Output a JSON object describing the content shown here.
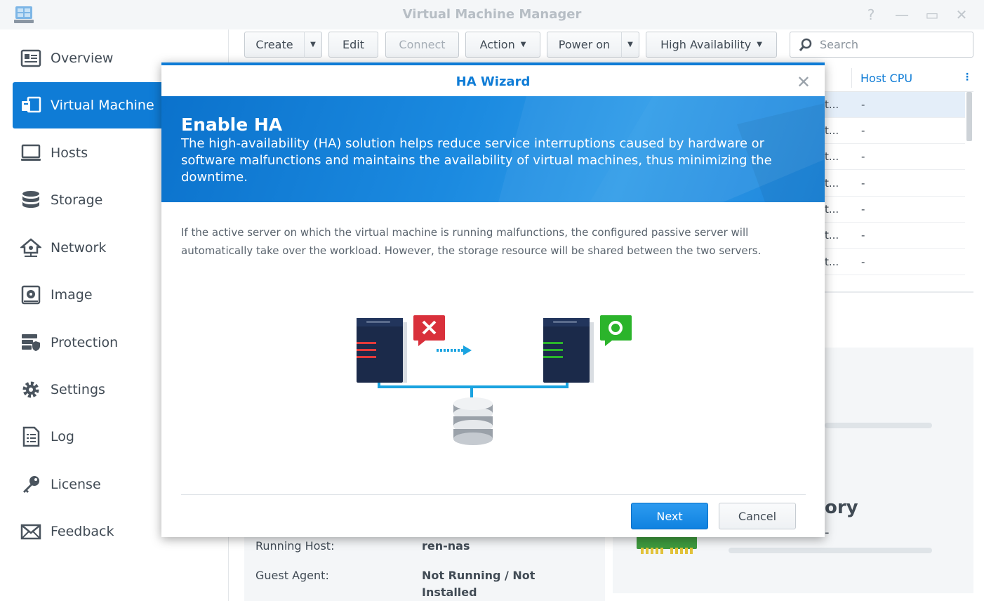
{
  "window": {
    "title": "Virtual Machine Manager",
    "help_icon": "?",
    "minimize_icon": "—",
    "maximize_icon": "▭",
    "close_icon": "✕"
  },
  "sidebar": {
    "items": [
      {
        "label": "Overview",
        "icon": "overview-icon",
        "active": false
      },
      {
        "label": "Virtual Machine",
        "icon": "virtual-machine-icon",
        "active": true
      },
      {
        "label": "Hosts",
        "icon": "hosts-icon",
        "active": false
      },
      {
        "label": "Storage",
        "icon": "storage-icon",
        "active": false
      },
      {
        "label": "Network",
        "icon": "network-icon",
        "active": false
      },
      {
        "label": "Image",
        "icon": "image-icon",
        "active": false
      },
      {
        "label": "Protection",
        "icon": "protection-icon",
        "active": false
      },
      {
        "label": "Settings",
        "icon": "settings-icon",
        "active": false
      },
      {
        "label": "Log",
        "icon": "log-icon",
        "active": false
      },
      {
        "label": "License",
        "icon": "license-icon",
        "active": false
      },
      {
        "label": "Feedback",
        "icon": "feedback-icon",
        "active": false
      }
    ]
  },
  "toolbar": {
    "create": "Create",
    "edit": "Edit",
    "connect": "Connect",
    "action": "Action",
    "power_on": "Power on",
    "high_availability": "High Availability",
    "search_placeholder": "Search"
  },
  "grid": {
    "columns": [
      "Host CPU"
    ],
    "rows": [
      {
        "c1": "t...",
        "c2": "-",
        "selected": true
      },
      {
        "c1": "t...",
        "c2": "-",
        "selected": false
      },
      {
        "c1": "t...",
        "c2": "-",
        "selected": false
      },
      {
        "c1": "t...",
        "c2": "-",
        "selected": false
      },
      {
        "c1": "t...",
        "c2": "-",
        "selected": false
      },
      {
        "c1": "t...",
        "c2": "-",
        "selected": false
      },
      {
        "c1": "t...",
        "c2": "-",
        "selected": false
      }
    ]
  },
  "summary": {
    "memory_title_fragment": "ory",
    "dash": "-",
    "running_host_label": "Running Host:",
    "running_host_value": "ren-nas",
    "guest_agent_label": "Guest Agent:",
    "guest_agent_value": "Not Running / Not Installed"
  },
  "dialog": {
    "title": "HA Wizard",
    "heading": "Enable HA",
    "description": "The high-availability (HA) solution helps reduce service interruptions caused by hardware or software malfunctions and maintains the availability of virtual machines, thus minimizing the downtime.",
    "body": "If the active server on which the virtual machine is running malfunctions, the configured passive server will automatically take over the workload. However, the storage resource will be shared between the two servers.",
    "next": "Next",
    "cancel": "Cancel"
  },
  "colors": {
    "accent": "#0f7cd6",
    "error": "#d9303b",
    "ok": "#2bb42b"
  }
}
